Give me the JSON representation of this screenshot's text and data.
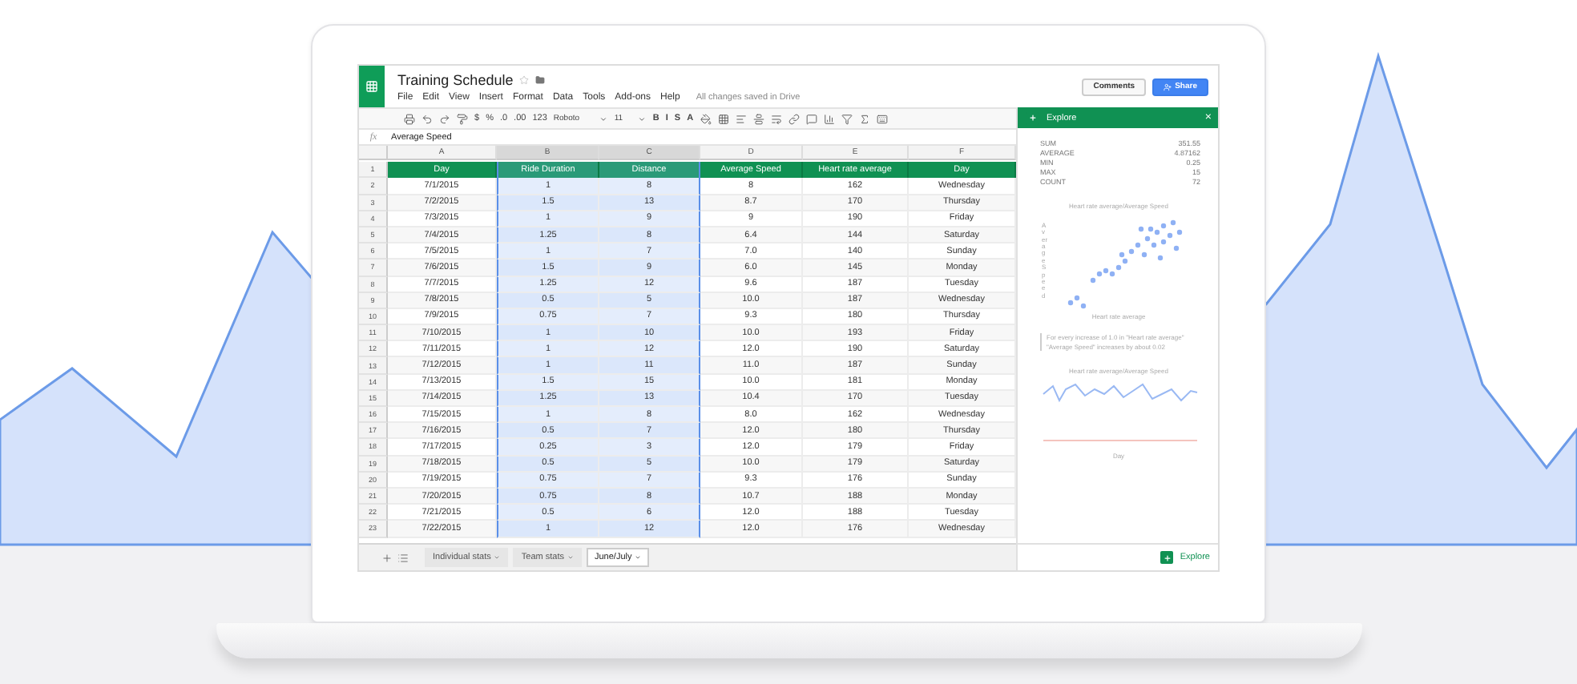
{
  "doc": {
    "title": "Training Schedule",
    "menu": [
      "File",
      "Edit",
      "View",
      "Insert",
      "Format",
      "Data",
      "Tools",
      "Add-ons",
      "Help"
    ],
    "save_status": "All changes saved in Drive",
    "buttons": [
      "Comments",
      "Share"
    ]
  },
  "toolbar": {
    "number_formats": [
      "$",
      "%",
      ".0",
      ".00",
      "123"
    ],
    "font": "Roboto",
    "size": "11",
    "styles": [
      "B",
      "I",
      "S",
      "A"
    ]
  },
  "formula_bar": {
    "label": "fx",
    "value": "Average Speed"
  },
  "columns": [
    {
      "letter": "A",
      "header": "Day",
      "selected": false
    },
    {
      "letter": "B",
      "header": "Ride Duration",
      "selected": true
    },
    {
      "letter": "C",
      "header": "Distance",
      "selected": true
    },
    {
      "letter": "D",
      "header": "Average Speed",
      "selected": false
    },
    {
      "letter": "E",
      "header": "Heart rate average",
      "selected": false
    },
    {
      "letter": "F",
      "header": "Day",
      "selected": false
    }
  ],
  "header_row_number": "1",
  "rows": [
    {
      "number": "2",
      "cells": [
        "7/1/2015",
        "1",
        "8",
        "8",
        "162",
        "Wednesday"
      ]
    },
    {
      "number": "3",
      "cells": [
        "7/2/2015",
        "1.5",
        "13",
        "8.7",
        "170",
        "Thursday"
      ]
    },
    {
      "number": "4",
      "cells": [
        "7/3/2015",
        "1",
        "9",
        "9",
        "190",
        "Friday"
      ]
    },
    {
      "number": "5",
      "cells": [
        "7/4/2015",
        "1.25",
        "8",
        "6.4",
        "144",
        "Saturday"
      ]
    },
    {
      "number": "6",
      "cells": [
        "7/5/2015",
        "1",
        "7",
        "7.0",
        "140",
        "Sunday"
      ]
    },
    {
      "number": "7",
      "cells": [
        "7/6/2015",
        "1.5",
        "9",
        "6.0",
        "145",
        "Monday"
      ]
    },
    {
      "number": "8",
      "cells": [
        "7/7/2015",
        "1.25",
        "12",
        "9.6",
        "187",
        "Tuesday"
      ]
    },
    {
      "number": "9",
      "cells": [
        "7/8/2015",
        "0.5",
        "5",
        "10.0",
        "187",
        "Wednesday"
      ]
    },
    {
      "number": "10",
      "cells": [
        "7/9/2015",
        "0.75",
        "7",
        "9.3",
        "180",
        "Thursday"
      ]
    },
    {
      "number": "11",
      "cells": [
        "7/10/2015",
        "1",
        "10",
        "10.0",
        "193",
        "Friday"
      ]
    },
    {
      "number": "12",
      "cells": [
        "7/11/2015",
        "1",
        "12",
        "12.0",
        "190",
        "Saturday"
      ]
    },
    {
      "number": "13",
      "cells": [
        "7/12/2015",
        "1",
        "11",
        "11.0",
        "187",
        "Sunday"
      ]
    },
    {
      "number": "14",
      "cells": [
        "7/13/2015",
        "1.5",
        "15",
        "10.0",
        "181",
        "Monday"
      ]
    },
    {
      "number": "15",
      "cells": [
        "7/14/2015",
        "1.25",
        "13",
        "10.4",
        "170",
        "Tuesday"
      ]
    },
    {
      "number": "16",
      "cells": [
        "7/15/2015",
        "1",
        "8",
        "8.0",
        "162",
        "Wednesday"
      ]
    },
    {
      "number": "17",
      "cells": [
        "7/16/2015",
        "0.5",
        "7",
        "12.0",
        "180",
        "Thursday"
      ]
    },
    {
      "number": "18",
      "cells": [
        "7/17/2015",
        "0.25",
        "3",
        "12.0",
        "179",
        "Friday"
      ]
    },
    {
      "number": "19",
      "cells": [
        "7/18/2015",
        "0.5",
        "5",
        "10.0",
        "179",
        "Saturday"
      ]
    },
    {
      "number": "20",
      "cells": [
        "7/19/2015",
        "0.75",
        "7",
        "9.3",
        "176",
        "Sunday"
      ]
    },
    {
      "number": "21",
      "cells": [
        "7/20/2015",
        "0.75",
        "8",
        "10.7",
        "188",
        "Monday"
      ]
    },
    {
      "number": "22",
      "cells": [
        "7/21/2015",
        "0.5",
        "6",
        "12.0",
        "188",
        "Tuesday"
      ]
    },
    {
      "number": "23",
      "cells": [
        "7/22/2015",
        "1",
        "12",
        "12.0",
        "176",
        "Wednesday"
      ]
    }
  ],
  "sheet_tabs": [
    {
      "label": "Individual stats",
      "selected": false
    },
    {
      "label": "Team stats",
      "selected": false
    },
    {
      "label": "June/July",
      "selected": true
    }
  ],
  "explore": {
    "title": "Explore",
    "close": "×",
    "stats": [
      {
        "label": "SUM",
        "value": "351.55"
      },
      {
        "label": "AVERAGE",
        "value": "4.87162"
      },
      {
        "label": "MIN",
        "value": "0.25"
      },
      {
        "label": "MAX",
        "value": "15"
      },
      {
        "label": "COUNT",
        "value": "72"
      }
    ],
    "scatter": {
      "title": "Heart rate average/Average Speed",
      "xlabel": "Heart rate average",
      "ylabel": "Average Speed"
    },
    "insight": "For every increase of 1.0 in \"Heart rate average\" \"Average Speed\" increases by about 0.02",
    "line": {
      "title": "Heart rate average/Average Speed",
      "xlabel": "Day"
    },
    "button": "Explore"
  }
}
